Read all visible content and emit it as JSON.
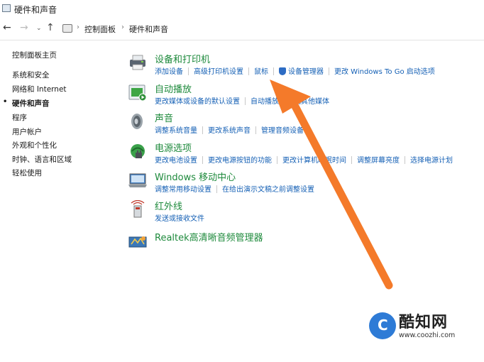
{
  "window": {
    "title": "硬件和声音"
  },
  "address": {
    "back": "←",
    "forward": "→",
    "dropdown": "⌄",
    "up": "↑",
    "crumbs": [
      "控制面板",
      "硬件和声音"
    ],
    "sep": "›"
  },
  "sidebar": {
    "items": [
      {
        "label": "控制面板主页",
        "current": false
      },
      {
        "label": "系统和安全",
        "current": false
      },
      {
        "label": "网络和 Internet",
        "current": false
      },
      {
        "label": "硬件和声音",
        "current": true
      },
      {
        "label": "程序",
        "current": false
      },
      {
        "label": "用户帐户",
        "current": false
      },
      {
        "label": "外观和个性化",
        "current": false
      },
      {
        "label": "时钟、语言和区域",
        "current": false
      },
      {
        "label": "轻松使用",
        "current": false
      }
    ],
    "bullet": "•"
  },
  "categories": [
    {
      "title": "设备和打印机",
      "links": [
        "添加设备",
        "高级打印机设置",
        "鼠标",
        "设备管理器",
        "更改 Windows To Go 启动选项"
      ]
    },
    {
      "title": "自动播放",
      "links": [
        "更改媒体或设备的默认设置",
        "自动播放 CD 或其他媒体"
      ]
    },
    {
      "title": "声音",
      "links": [
        "调整系统音量",
        "更改系统声音",
        "管理音频设备"
      ]
    },
    {
      "title": "电源选项",
      "links": [
        "更改电池设置",
        "更改电源按钮的功能",
        "更改计算机睡眠时间",
        "调整屏幕亮度",
        "选择电源计划"
      ]
    },
    {
      "title": "Windows 移动中心",
      "links": [
        "调整常用移动设置",
        "在给出演示文稿之前调整设置"
      ]
    },
    {
      "title": "红外线",
      "links": [
        "发送或接收文件"
      ]
    },
    {
      "title": "Realtek高清晰音频管理器",
      "links": []
    }
  ],
  "watermark": {
    "brand": "酷知网",
    "url": "www.coozhi.com",
    "logo_letter": "C"
  },
  "colors": {
    "accent_arrow": "#f47a2a",
    "link": "#1560b5",
    "category_title": "#1e8a3c"
  }
}
